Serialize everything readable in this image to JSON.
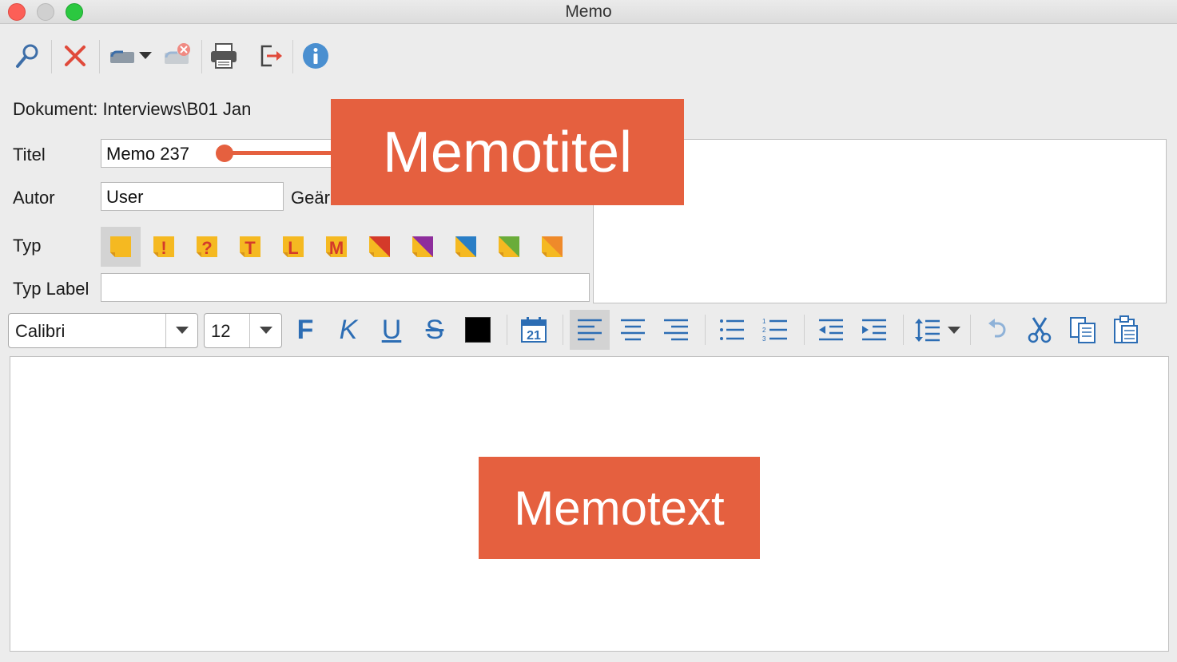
{
  "window": {
    "title": "Memo"
  },
  "toolbar": {
    "items": [
      "search-icon",
      "delete-icon",
      "link-dropdown-icon",
      "unlink-icon",
      "print-icon",
      "export-icon",
      "info-icon"
    ]
  },
  "document": {
    "label": "Dokument: Interviews\\B01 Jan"
  },
  "form": {
    "title_label": "Titel",
    "title_value": "Memo 237",
    "author_label": "Autor",
    "author_value": "User",
    "changed_label": "Geär",
    "type_label": "Typ",
    "type_label_label": "Typ Label",
    "type_label_value": ""
  },
  "memo_types": [
    {
      "name": "plain",
      "glyph": "",
      "color": "#f5b921"
    },
    {
      "name": "exclamation",
      "glyph": "!",
      "color": "#f5b921"
    },
    {
      "name": "question",
      "glyph": "?",
      "color": "#f5b921"
    },
    {
      "name": "t",
      "glyph": "T",
      "color": "#f5b921"
    },
    {
      "name": "l",
      "glyph": "L",
      "color": "#f5b921"
    },
    {
      "name": "m",
      "glyph": "M",
      "color": "#f5b921"
    },
    {
      "name": "red",
      "glyph": "",
      "color": "#d43a2a"
    },
    {
      "name": "purple",
      "glyph": "",
      "color": "#8e2e9c"
    },
    {
      "name": "blue",
      "glyph": "",
      "color": "#2a7ec6"
    },
    {
      "name": "green",
      "glyph": "",
      "color": "#6aac3a"
    },
    {
      "name": "orange",
      "glyph": "",
      "color": "#ef8a2a"
    }
  ],
  "format": {
    "font": "Calibri",
    "size": "12",
    "bold": "F",
    "italic": "K",
    "underline": "U",
    "strike": "S",
    "color": "#000000",
    "date_day": "21"
  },
  "callouts": {
    "title": "Memotitel",
    "text": "Memotext"
  },
  "colors": {
    "accent": "#e5603f",
    "icon_blue": "#2c6db4"
  }
}
